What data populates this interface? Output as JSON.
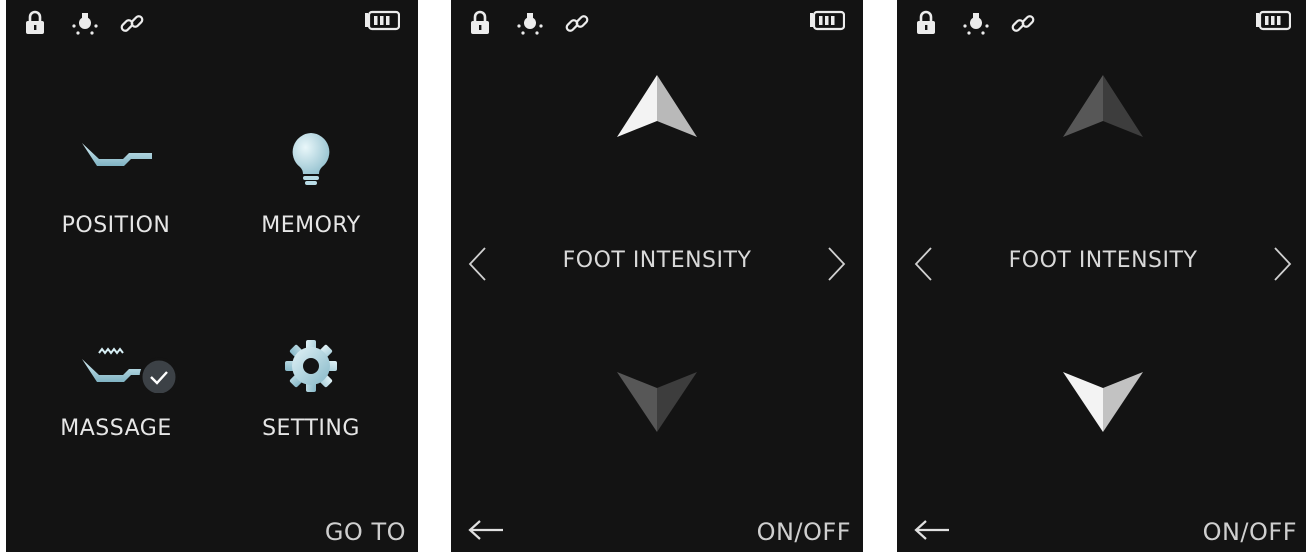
{
  "screens": [
    {
      "type": "menu",
      "status_icons": [
        "lock-icon",
        "bulb-icon",
        "link-icon",
        "battery-icon"
      ],
      "menu": [
        {
          "label": "POSITION",
          "icon": "bed-position-icon"
        },
        {
          "label": "MEMORY",
          "icon": "lightbulb-icon"
        },
        {
          "label": "MASSAGE",
          "icon": "massage-icon",
          "selected": true
        },
        {
          "label": "SETTING",
          "icon": "gear-icon"
        }
      ],
      "footer": "GO TO"
    },
    {
      "type": "adjust",
      "status_icons": [
        "lock-icon",
        "bulb-icon",
        "link-icon",
        "battery-icon"
      ],
      "label": "FOOT INTENSITY",
      "active_arrow": "up",
      "footer": "ON/OFF"
    },
    {
      "type": "adjust",
      "status_icons": [
        "lock-icon",
        "bulb-icon",
        "link-icon",
        "battery-icon"
      ],
      "label": "FOOT INTENSITY",
      "active_arrow": "down",
      "footer": "ON/OFF"
    }
  ],
  "colors": {
    "background": "#131313",
    "text": "#e6e6e6",
    "accent_icon": "#b9dce6",
    "arrow_active": "#f2f2f2",
    "arrow_inactive": "#4a4a4a"
  }
}
